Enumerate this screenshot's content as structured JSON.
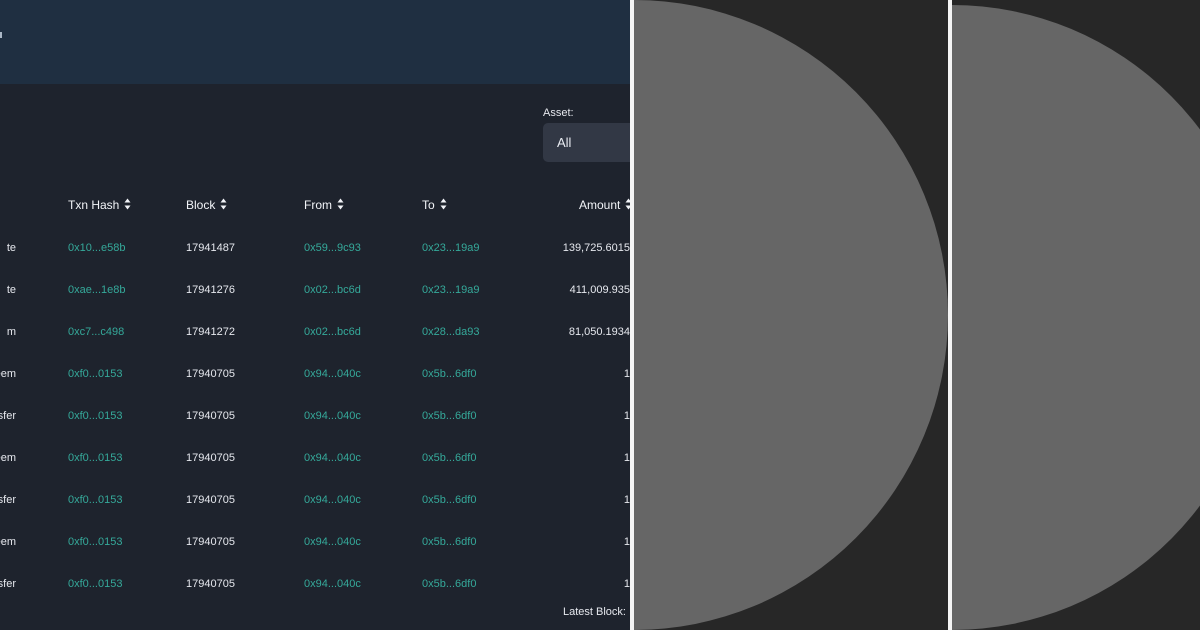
{
  "filter": {
    "asset_label": "Asset:",
    "asset_value": "All"
  },
  "table": {
    "headers": {
      "hash": "Txn Hash",
      "block": "Block",
      "from": "From",
      "to": "To",
      "amount": "Amount"
    },
    "rows": [
      {
        "type": "te",
        "hash": "0x10...e58b",
        "block": "17941487",
        "from": "0x59...9c93",
        "to": "0x23...19a9",
        "amount": "139,725.6015"
      },
      {
        "type": "te",
        "hash": "0xae...1e8b",
        "block": "17941276",
        "from": "0x02...bc6d",
        "to": "0x23...19a9",
        "amount": "411,009.935"
      },
      {
        "type": "m",
        "hash": "0xc7...c498",
        "block": "17941272",
        "from": "0x02...bc6d",
        "to": "0x28...da93",
        "amount": "81,050.1934"
      },
      {
        "type": "eem",
        "hash": "0xf0...0153",
        "block": "17940705",
        "from": "0x94...040c",
        "to": "0x5b...6df0",
        "amount": "1"
      },
      {
        "type": "nsfer",
        "hash": "0xf0...0153",
        "block": "17940705",
        "from": "0x94...040c",
        "to": "0x5b...6df0",
        "amount": "1"
      },
      {
        "type": "eem",
        "hash": "0xf0...0153",
        "block": "17940705",
        "from": "0x94...040c",
        "to": "0x5b...6df0",
        "amount": "1"
      },
      {
        "type": "nsfer",
        "hash": "0xf0...0153",
        "block": "17940705",
        "from": "0x94...040c",
        "to": "0x5b...6df0",
        "amount": "1"
      },
      {
        "type": "eem",
        "hash": "0xf0...0153",
        "block": "17940705",
        "from": "0x94...040c",
        "to": "0x5b...6df0",
        "amount": "1"
      },
      {
        "type": "nsfer",
        "hash": "0xf0...0153",
        "block": "17940705",
        "from": "0x94...040c",
        "to": "0x5b...6df0",
        "amount": "1"
      }
    ]
  },
  "footer": {
    "latest_block_label": "Latest Block:"
  },
  "icons": {
    "sort": "sort-icon"
  },
  "colors": {
    "page_bg": "#1e232d",
    "topbar_bg": "#1f2f41",
    "link": "#35a99a",
    "text": "#e6e8ee",
    "select_bg": "#323845",
    "overlay_bg": "#272727",
    "overlay_shape": "#666666"
  }
}
